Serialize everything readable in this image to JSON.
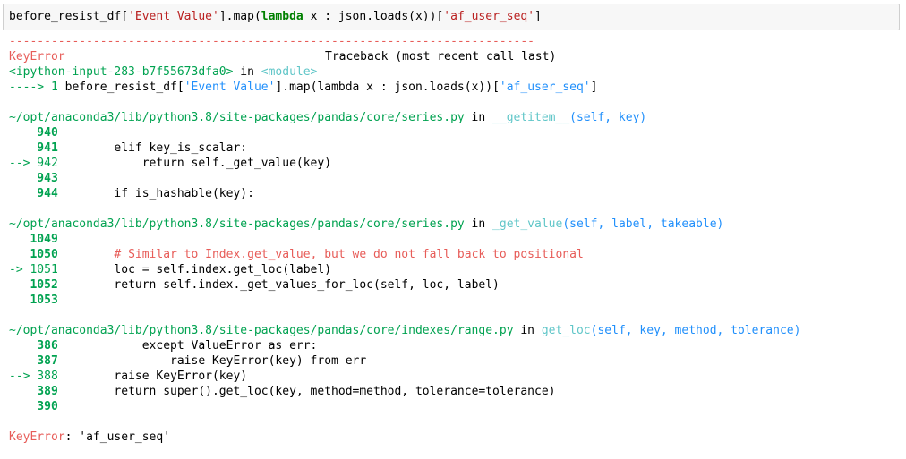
{
  "input": {
    "pre": "before_resist_df[",
    "str1": "'Event Value'",
    "mid1": "].map(",
    "kw_lambda": "lambda",
    "mid2": " x : json.loads(x))[",
    "str2": "'af_user_seq'",
    "post": "]"
  },
  "traceback": {
    "dashes": "---------------------------------------------------------------------------",
    "error_name": "KeyError",
    "header_right": "Traceback (most recent call last)",
    "ipython_input": "<ipython-input-283-b7f55673dfa0>",
    "in_word": " in ",
    "module": "<module>",
    "arrow_line_prefix": "----> 1 ",
    "arrow_line_code_a": "before_resist_df[",
    "arrow_line_str1": "'Event Value'",
    "arrow_line_code_b": "].map(lambda x : json.loads(x))[",
    "arrow_line_str2": "'af_user_seq'",
    "arrow_line_code_c": "]",
    "frames": [
      {
        "path": "~/opt/anaconda3/lib/python3.8/site-packages/pandas/core/series.py",
        "in_word": " in ",
        "func": "__getitem__",
        "args": "(self, key)",
        "lines": [
          {
            "no": "    940",
            "arrow": false,
            "code": ""
          },
          {
            "no": "    941",
            "arrow": false,
            "code": "        elif key_is_scalar:"
          },
          {
            "no": "--> 942",
            "arrow": true,
            "code": "            return self._get_value(key)"
          },
          {
            "no": "    943",
            "arrow": false,
            "code": ""
          },
          {
            "no": "    944",
            "arrow": false,
            "code": "        if is_hashable(key):"
          }
        ]
      },
      {
        "path": "~/opt/anaconda3/lib/python3.8/site-packages/pandas/core/series.py",
        "in_word": " in ",
        "func": "_get_value",
        "args": "(self, label, takeable)",
        "lines": [
          {
            "no": "   1049",
            "arrow": false,
            "code": ""
          },
          {
            "no": "   1050",
            "arrow": false,
            "code": "        # Similar to Index.get_value, but we do not fall back to positional",
            "comment": true
          },
          {
            "no": "-> 1051",
            "arrow": true,
            "code": "        loc = self.index.get_loc(label)"
          },
          {
            "no": "   1052",
            "arrow": false,
            "code": "        return self.index._get_values_for_loc(self, loc, label)"
          },
          {
            "no": "   1053",
            "arrow": false,
            "code": ""
          }
        ]
      },
      {
        "path": "~/opt/anaconda3/lib/python3.8/site-packages/pandas/core/indexes/range.py",
        "in_word": " in ",
        "func": "get_loc",
        "args": "(self, key, method, tolerance)",
        "lines": [
          {
            "no": "    386",
            "arrow": false,
            "code": "            except ValueError as err:"
          },
          {
            "no": "    387",
            "arrow": false,
            "code": "                raise KeyError(key) from err"
          },
          {
            "no": "--> 388",
            "arrow": true,
            "code": "        raise KeyError(key)"
          },
          {
            "no": "    389",
            "arrow": false,
            "code": "        return super().get_loc(key, method=method, tolerance=tolerance)"
          },
          {
            "no": "    390",
            "arrow": false,
            "code": ""
          }
        ]
      }
    ],
    "final_error_name": "KeyError",
    "final_error_msg": ": 'af_user_seq'"
  }
}
